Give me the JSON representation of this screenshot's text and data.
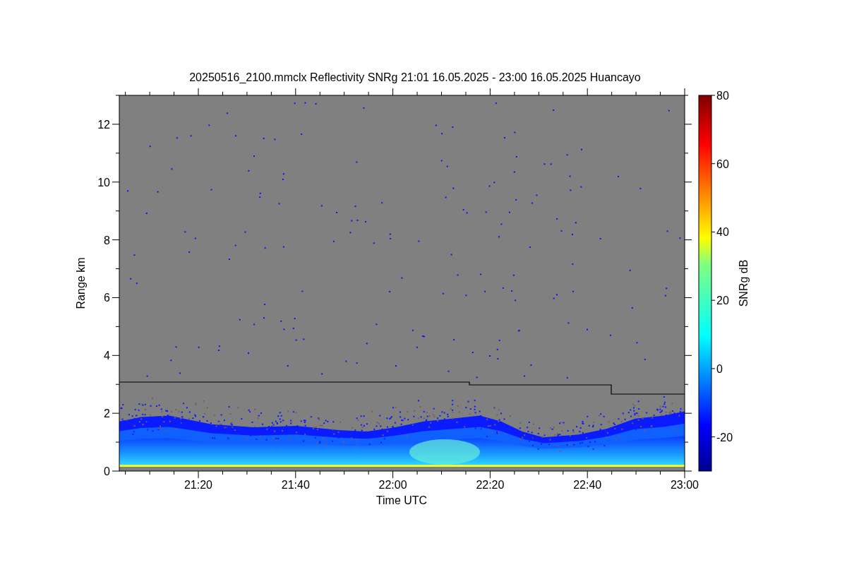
{
  "title": "20250516_2100.mmclx Reflectivity SNRg   21:01 16.05.2025 - 23:00 16.05.2025 Huancayo",
  "y_axis": {
    "label": "Range km",
    "ticks": [
      "12",
      "10",
      "8",
      "6",
      "4",
      "2",
      "0"
    ]
  },
  "x_axis": {
    "label": "Time UTC",
    "ticks": [
      "21:20",
      "21:40",
      "22:00",
      "22:20",
      "22:40",
      "23:00"
    ]
  },
  "colorbar": {
    "label": "SNRg dB",
    "ticks": [
      "80",
      "60",
      "40",
      "20",
      "0",
      "-20"
    ]
  }
}
